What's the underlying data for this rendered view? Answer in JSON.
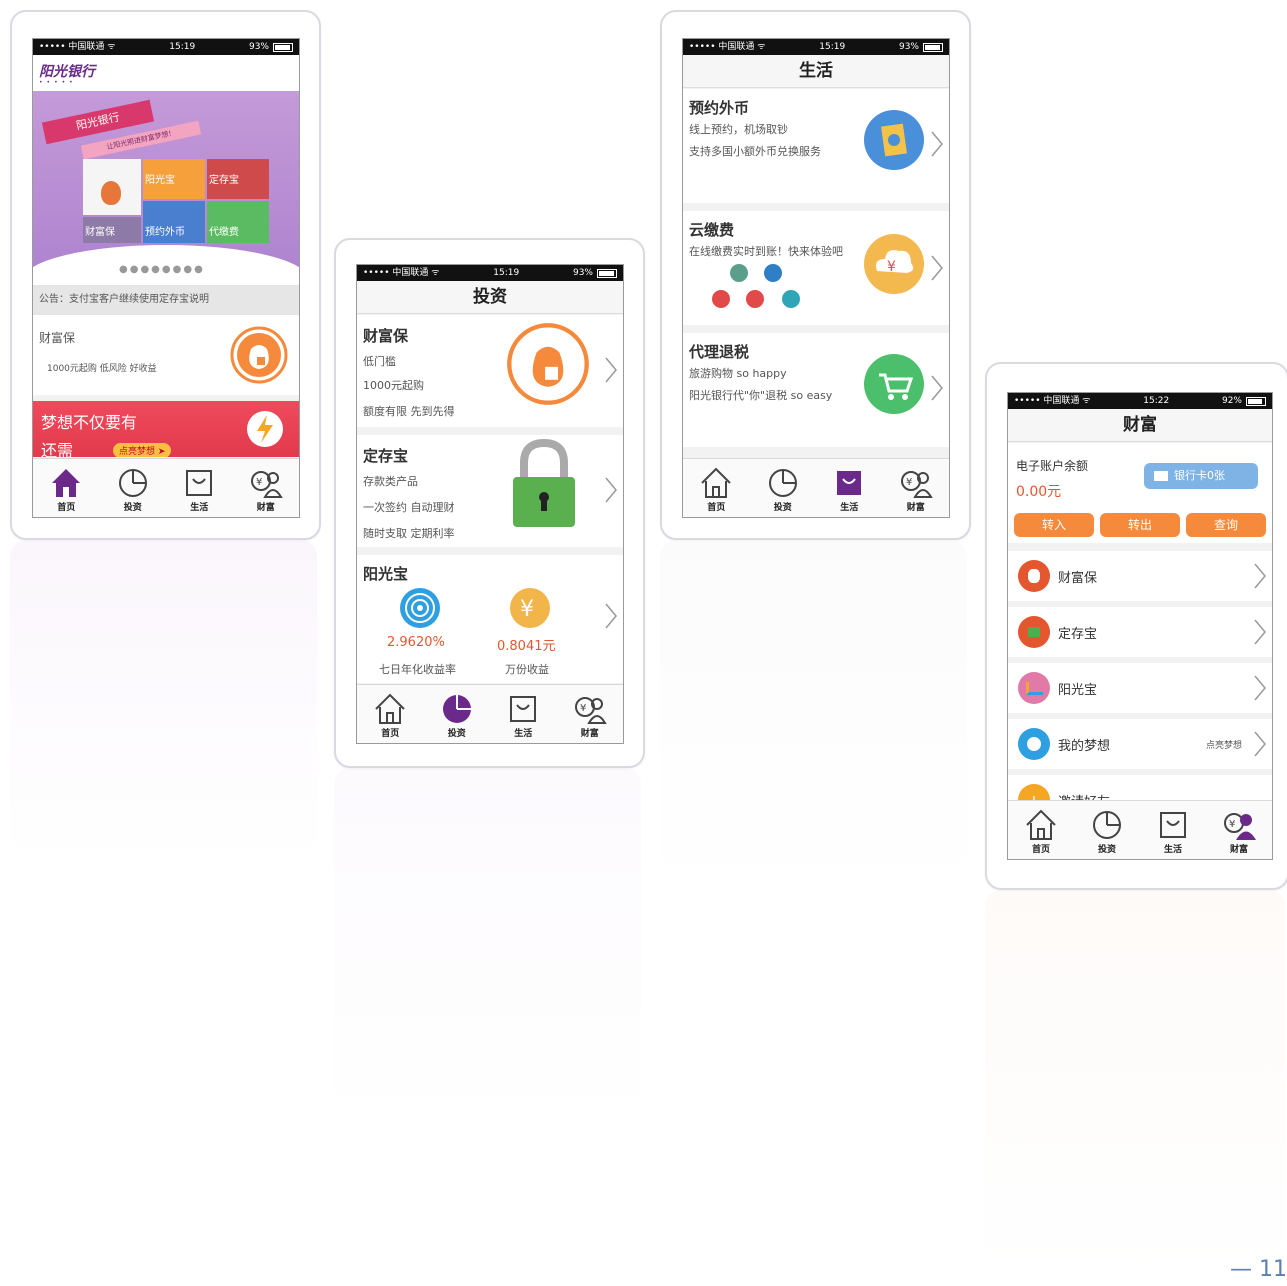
{
  "status": {
    "carrier": "••••• 中国联通 ᯤ",
    "time_a": "15:19",
    "time_b": "15:22",
    "battery_a": "93%",
    "battery_b": "92%"
  },
  "tabs": [
    "首页",
    "投资",
    "生活",
    "财富"
  ],
  "home": {
    "logo": "阳光银行",
    "banner_tag": "阳光银行",
    "banner_sub": "让阳光照进财富梦想！",
    "tile_labels": [
      "阳光宝",
      "定存宝",
      "财富保",
      "预约外币",
      "代缴费"
    ],
    "notice": "公告：支付宝客户继续使用定存宝说明",
    "product_title": "财富保",
    "product_desc": "1000元起购  低风险  好收益",
    "dream_text": "梦想不仅要有",
    "dream_text2": "还需",
    "dream_button": "点亮梦想 ➤"
  },
  "invest": {
    "title": "投资",
    "fortune": {
      "name": "财富保",
      "lines": [
        "低门槛",
        "1000元起购",
        "额度有限 先到先得"
      ]
    },
    "deposit": {
      "name": "定存宝",
      "lines": [
        "存款类产品",
        "一次签约 自动理财",
        "随时支取 定期利率"
      ]
    },
    "sunshine": {
      "name": "阳光宝",
      "rate": "2.9620%",
      "rate_label": "七日年化收益率",
      "earn": "0.8041元",
      "earn_label": "万份收益"
    }
  },
  "life": {
    "title": "生活",
    "items": [
      {
        "name": "预约外币",
        "lines": [
          "线上预约，机场取钞",
          "支持多国小额外币兑换服务"
        ]
      },
      {
        "name": "云缴费",
        "lines": [
          "在线缴费实时到账！快来体验吧"
        ]
      },
      {
        "name": "代理退税",
        "lines": [
          "旅游购物 so happy",
          "阳光银行代\"你\"退税 so easy"
        ]
      }
    ]
  },
  "wealth": {
    "title": "财富",
    "balance_label": "电子账户余额",
    "balance": "0.00元",
    "bank_card": "银行卡0张",
    "actions": [
      "转入",
      "转出",
      "查询"
    ],
    "rows": [
      {
        "label": "财富保",
        "extra": ""
      },
      {
        "label": "定存宝",
        "extra": ""
      },
      {
        "label": "阳光宝",
        "extra": ""
      },
      {
        "label": "我的梦想",
        "extra": "点亮梦想"
      },
      {
        "label": "邀请好友",
        "extra": ""
      }
    ]
  },
  "page_number": "— 11",
  "colors": {
    "orange": "#f58a3c",
    "purple": "#6b2a8a",
    "green": "#4caf50",
    "blue": "#3b8fd6"
  }
}
